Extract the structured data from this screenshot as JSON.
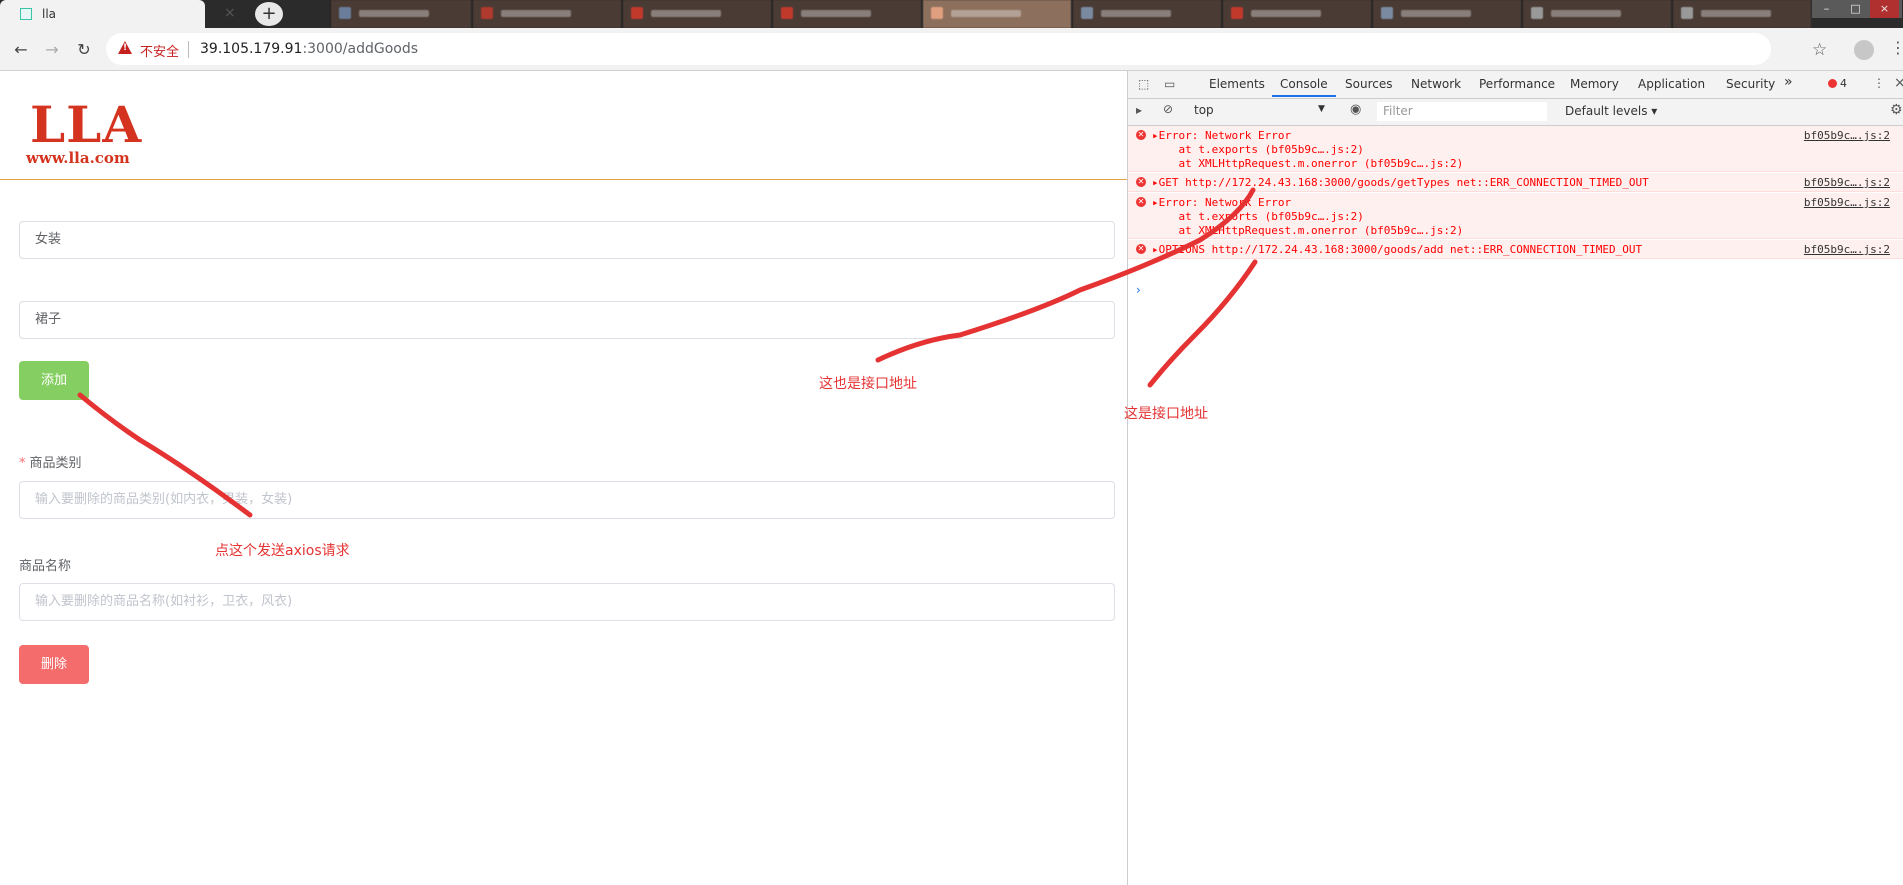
{
  "browser": {
    "tab_title": "lla",
    "tab_close": "×",
    "new_tab": "+",
    "window_buttons": [
      "–",
      "□",
      "×"
    ],
    "back": "←",
    "forward": "→",
    "reload": "↻",
    "insecure_label": "不安全",
    "url_host": "39.105.179.91",
    "url_path": ":3000/addGoods",
    "star": "☆",
    "menu": "⋮"
  },
  "page": {
    "logo": "LLA",
    "logo_sub": "www.lla.com",
    "add_form": {
      "category_value": "女装",
      "name_value": "裙子",
      "add_button": "添加"
    },
    "delete_form": {
      "required_mark": "*",
      "category_label": "商品类别",
      "category_placeholder": "输入要删除的商品类别(如内衣，男装，女装)",
      "name_label": "商品名称",
      "name_placeholder": "输入要删除的商品名称(如衬衫，卫衣，风衣)",
      "delete_button": "删除"
    }
  },
  "devtools": {
    "inspect": "⬚",
    "device": "▭",
    "tabs": [
      "Elements",
      "Console",
      "Sources",
      "Network",
      "Performance",
      "Memory",
      "Application",
      "Security"
    ],
    "active_tab": "Console",
    "more": "»",
    "error_count": "4",
    "kebab": "⋮",
    "close": "×",
    "sidebar_toggle": "▸",
    "clear": "⊘",
    "context": "top",
    "context_arrow": "▼",
    "eye": "◉",
    "filter_placeholder": "Filter",
    "levels": "Default levels ▾",
    "gear": "⚙",
    "messages": [
      {
        "line1": "▸Error: Network Error",
        "line2": "    at t.exports (bf05b9c….js:2)",
        "line3": "    at XMLHttpRequest.m.onerror (bf05b9c….js:2)",
        "source": "bf05b9c….js:2"
      },
      {
        "line1": "▸GET http://172.24.43.168:3000/goods/getTypes net::ERR_CONNECTION_TIMED_OUT",
        "source": "bf05b9c….js:2"
      },
      {
        "line1": "▸Error: Network Error",
        "line2": "    at t.exports (bf05b9c….js:2)",
        "line3": "    at XMLHttpRequest.m.onerror (bf05b9c….js:2)",
        "source": "bf05b9c….js:2"
      },
      {
        "line1": "▸OPTIONS http://172.24.43.168:3000/goods/add net::ERR_CONNECTION_TIMED_OUT",
        "source": "bf05b9c….js:2"
      }
    ],
    "prompt": "›"
  },
  "annotations": {
    "click_note": "点这个发送axios请求",
    "api_note_1": "这也是接口地址",
    "api_note_2": "这是接口地址",
    "color": "#e53333"
  }
}
